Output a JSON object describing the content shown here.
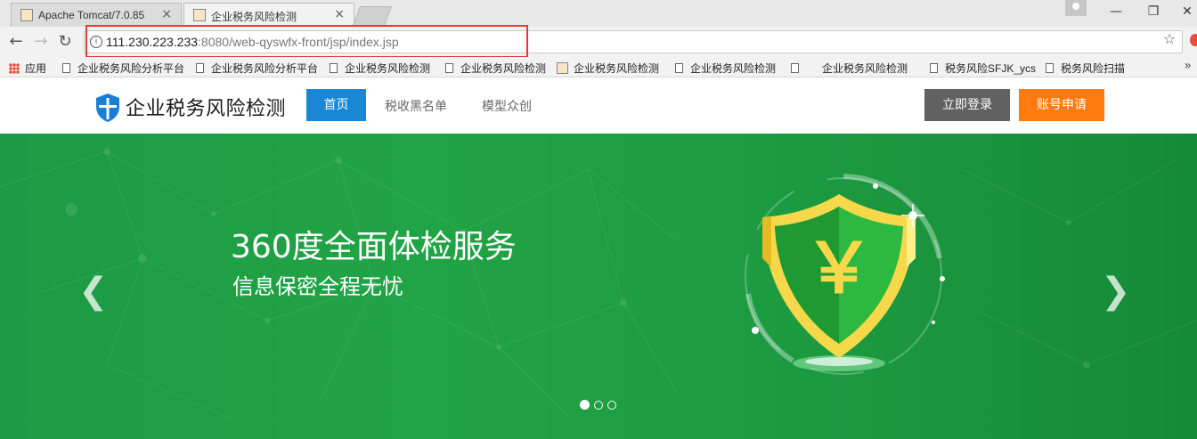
{
  "browser": {
    "tabs": [
      {
        "label": "Apache Tomcat/7.0.85",
        "active": false
      },
      {
        "label": "企业税务风险检测",
        "active": true
      }
    ],
    "close_glyph": "×",
    "url_host": "111.230.223.233",
    "url_rest": ":8080/web-qyswfx-front/jsp/index.jsp",
    "bookmarks": [
      {
        "label": "应用",
        "icon": "apps-icon"
      },
      {
        "label": "企业税务风险分析平台",
        "icon": "page-icon"
      },
      {
        "label": "企业税务风险分析平台",
        "icon": "page-icon"
      },
      {
        "label": "企业税务风险检测",
        "icon": "page-icon"
      },
      {
        "label": "企业税务风险检测",
        "icon": "page-icon"
      },
      {
        "label": "企业税务风险检测",
        "icon": "favicon-icon"
      },
      {
        "label": "企业税务风险检测",
        "icon": "page-icon"
      },
      {
        "label": "企业税务风险检测",
        "icon": "page-icon"
      },
      {
        "label": "税务风险SFJK_ycs",
        "icon": "page-icon"
      },
      {
        "label": "税务风险扫描",
        "icon": "page-icon"
      }
    ]
  },
  "site": {
    "logo_text": "企业税务风险检测",
    "nav": {
      "home": "首页",
      "blacklist": "税收黑名单",
      "model": "模型众创"
    },
    "login_button": "立即登录",
    "apply_button": "账号申请",
    "accent": "#1787d6",
    "apply_color": "#ff7b10"
  },
  "banner": {
    "title": "360度全面体检服务",
    "subtitle": "信息保密全程无忧",
    "currency_symbol": "￥",
    "prev_glyph": "❮",
    "next_glyph": "❯",
    "slides": 3,
    "active_slide": 1,
    "background": "#1e9e43"
  }
}
